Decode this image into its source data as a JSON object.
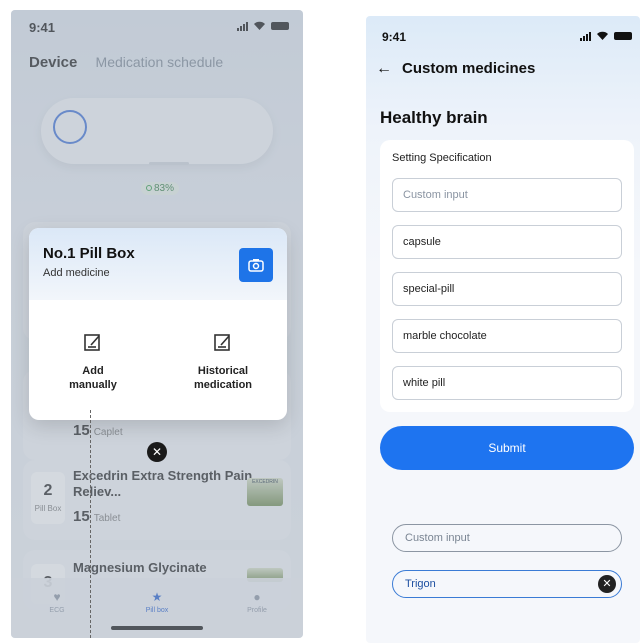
{
  "left_screen": {
    "status": {
      "time": "9:41"
    },
    "tabs": {
      "device": "Device",
      "schedule": "Medication schedule"
    },
    "battery_percent": "83%",
    "list": [
      {
        "slot": "",
        "slot_label": "",
        "name": "",
        "qty": "15",
        "unit": "Caplet"
      },
      {
        "slot": "2",
        "slot_label": "Pill Box",
        "name": "Excedrin Extra Strength Pain Reliev...",
        "qty": "15",
        "unit": "Tablet"
      },
      {
        "slot": "3",
        "slot_label": "",
        "name": "Magnesium Glycinate",
        "qty": "",
        "unit": ""
      }
    ],
    "modal": {
      "title": "No.1 Pill Box",
      "subtitle": "Add medicine",
      "option_manual": "Add manually",
      "option_history": "Historical medication"
    },
    "nav": {
      "ecg": "ECG",
      "pillbox": "Pill box",
      "profile": "Profile"
    },
    "thumb_text": "EXCEDRIN"
  },
  "right_screen": {
    "status": {
      "time": "9:41"
    },
    "header": {
      "back": "←",
      "title": "Custom medicines"
    },
    "page_title": "Healthy brain",
    "spec": {
      "label": "Setting Specification",
      "fields": [
        {
          "value": "Custom input",
          "placeholder": true
        },
        {
          "value": "capsule",
          "placeholder": false
        },
        {
          "value": "special-pill",
          "placeholder": false
        },
        {
          "value": "marble chocolate",
          "placeholder": false
        },
        {
          "value": "white pill",
          "placeholder": false
        }
      ]
    },
    "submit_label": "Submit",
    "custom_input_placeholder": "Custom input",
    "typed_value": "Trigon"
  },
  "colors": {
    "accent": "#1e74f0",
    "camera": "#1e74e8"
  }
}
